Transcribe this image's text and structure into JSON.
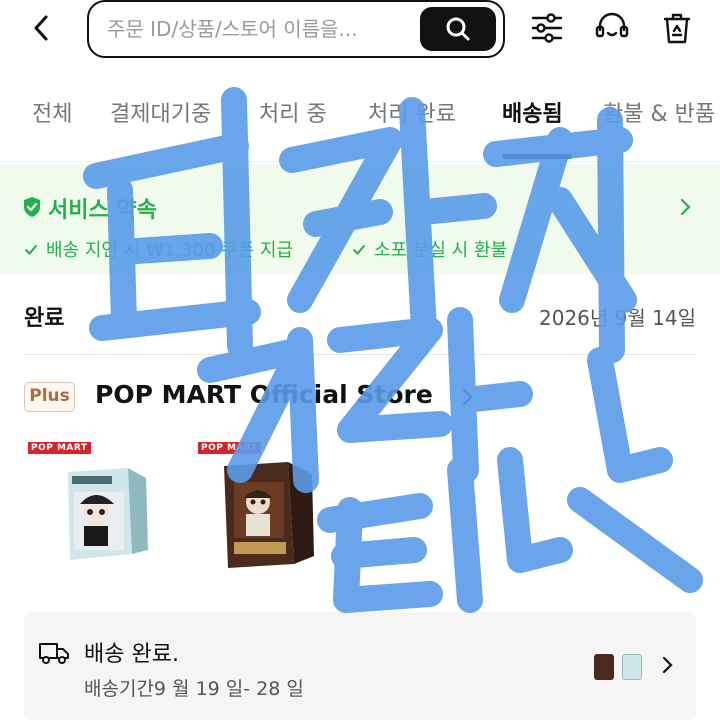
{
  "search": {
    "placeholder": "주문 ID/상품/스토어 이름을..."
  },
  "tabs": [
    {
      "label": "전체"
    },
    {
      "label": "결제대기중"
    },
    {
      "label": "처리 중"
    },
    {
      "label": "처리 완료"
    },
    {
      "label": "배송됨"
    },
    {
      "label": "환불 & 반품"
    }
  ],
  "active_tab": "배송됨",
  "promise": {
    "title": "서비스 약속",
    "items": [
      {
        "label": "배송 지연 시 ₩1,300 쿠폰 지급"
      },
      {
        "label": "소포 분실 시 환불"
      }
    ]
  },
  "order": {
    "status": "완료",
    "date": "2026년 9월 14일",
    "badge": "Plus",
    "store": "POP MART Official Store",
    "product_brand": "POP MART",
    "delivery_title": "배송 완료.",
    "delivery_period": "배송기간9 월 19 일- 28 일"
  },
  "watermark": {
    "text": "티카 직거래 탭 구매"
  },
  "colors": {
    "accent_green": "#22b14c",
    "watermark_blue": "#5a9be8",
    "popmart_red": "#d8232a"
  },
  "icons": [
    "chevron-left-icon",
    "search-icon",
    "filter-sliders-icon",
    "headset-icon",
    "trash-icon",
    "shield-check-icon",
    "check-icon",
    "chevron-right-icon",
    "truck-icon"
  ]
}
